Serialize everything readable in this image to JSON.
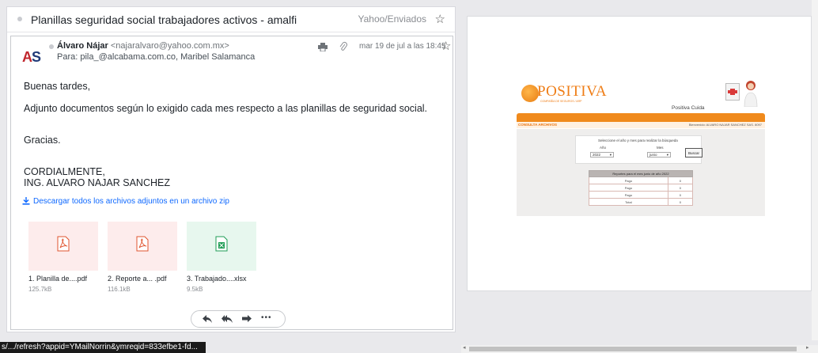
{
  "email": {
    "subject": "Planillas seguridad social trabajadores activos - amalfi",
    "folder": "Yahoo/Enviados",
    "sender_name": "Álvaro Nájar",
    "sender_email": "<najaralvaro@yahoo.com.mx>",
    "recipients": "Para: pila_@alcabama.com.co,  Maribel Salamanca",
    "date": "mar 19 de jul a las 18:45",
    "avatar_initials_a": "A",
    "avatar_initials_s": "S",
    "body": {
      "greeting": "Buenas tardes,",
      "line1": "Adjunto documentos según lo exigido cada mes respecto a las planillas de seguridad social.",
      "thanks": "Gracias.",
      "closing": "CORDIALMENTE,",
      "signature": "ING.  ALVARO NAJAR SANCHEZ"
    },
    "download_all": "Descargar todos los archivos adjuntos en un archivo zip",
    "attachments": [
      {
        "name": "1. Planilla de....pdf",
        "size": "125.7kB",
        "type": "pdf"
      },
      {
        "name": "2. Reporte a... .pdf",
        "size": "116.1kB",
        "type": "pdf"
      },
      {
        "name": "3. Trabajado....xlsx",
        "size": "9.5kB",
        "type": "xlsx"
      }
    ],
    "actions": {
      "reply": "reply-icon",
      "reply_all": "reply-all-icon",
      "forward": "forward-icon",
      "more": "•••"
    }
  },
  "status_url": "s/.../refresh?appid=YMailNorrin&ymreqid=833efbe1-fd...",
  "preview": {
    "logo_text": "POSITIVA",
    "logo_subtitle": "COMPAÑÍA DE SEGUROS / ARP",
    "brand_label": "Positiva Cuida",
    "section_title": "CONSULTA ARCHIVOS",
    "welcome_text": "Bienvenido: ALVARO NAJAR SANCHEZ  SAS. 8097",
    "search_prompt": "Seleccione el año y mes para realizar la búsqueda",
    "year_label": "Año",
    "month_label": "Mes",
    "year_value": "2022",
    "month_value": "junio",
    "search_button": "Buscar",
    "table_header": "Reportes para el mes junio de año 2022",
    "table_rows": [
      {
        "label": "Pago",
        "value": "0"
      },
      {
        "label": "Pago",
        "value": "0"
      },
      {
        "label": "Pago",
        "value": "0"
      },
      {
        "label": "Total",
        "value": "0"
      }
    ]
  },
  "colors": {
    "accent_orange": "#f08a1c",
    "link_blue": "#0f69ff",
    "pdf_tile": "#fdecec",
    "xls_tile": "#e7f7ee"
  }
}
